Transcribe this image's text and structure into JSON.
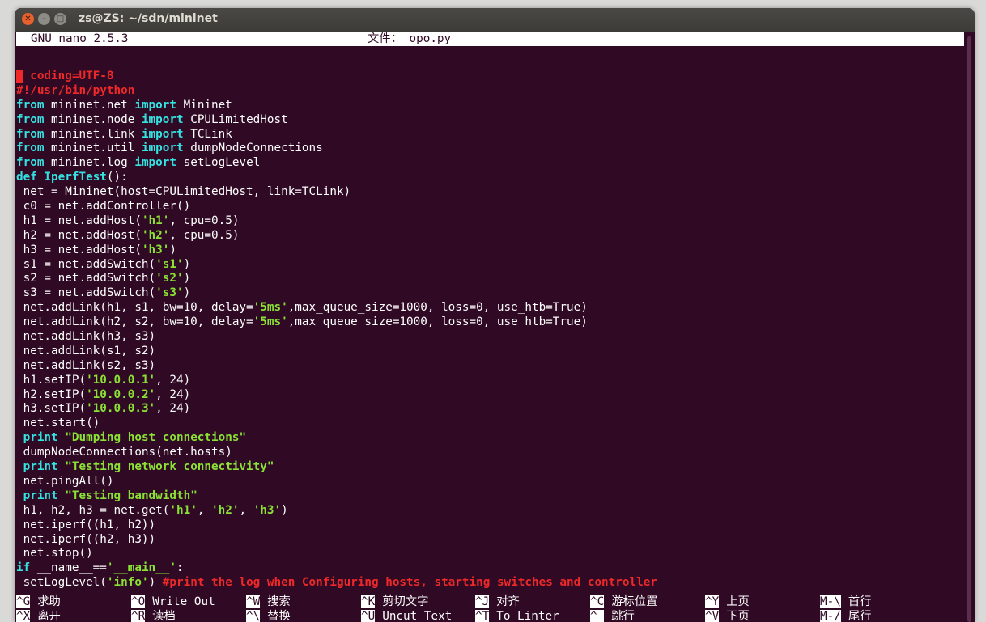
{
  "window": {
    "title": "zs@ZS: ~/sdn/mininet"
  },
  "nano": {
    "version": "GNU nano 2.5.3",
    "file_label": "文件：",
    "file_name": "opo.py"
  },
  "colors": {
    "background": "#300a24",
    "keyword": "#34e2e2",
    "string": "#8ae234",
    "comment": "#ef2929",
    "text": "#ffffff"
  },
  "code_lines": [
    [
      {
        "t": "#",
        "c": "cursor"
      },
      {
        "t": " coding=UTF-8",
        "c": "cmt"
      }
    ],
    [
      {
        "t": "#!/usr/bin/python",
        "c": "cmt"
      }
    ],
    [
      {
        "t": "from",
        "c": "kw"
      },
      {
        "t": " mininet.net "
      },
      {
        "t": "import",
        "c": "kw"
      },
      {
        "t": " Mininet"
      }
    ],
    [
      {
        "t": "from",
        "c": "kw"
      },
      {
        "t": " mininet.node "
      },
      {
        "t": "import",
        "c": "kw"
      },
      {
        "t": " CPULimitedHost"
      }
    ],
    [
      {
        "t": "from",
        "c": "kw"
      },
      {
        "t": " mininet.link "
      },
      {
        "t": "import",
        "c": "kw"
      },
      {
        "t": " TCLink"
      }
    ],
    [
      {
        "t": "from",
        "c": "kw"
      },
      {
        "t": " mininet.util "
      },
      {
        "t": "import",
        "c": "kw"
      },
      {
        "t": " dumpNodeConnections"
      }
    ],
    [
      {
        "t": "from",
        "c": "kw"
      },
      {
        "t": " mininet.log "
      },
      {
        "t": "import",
        "c": "kw"
      },
      {
        "t": " setLogLevel"
      }
    ],
    [
      {
        "t": "def",
        "c": "kw"
      },
      {
        "t": " "
      },
      {
        "t": "IperfTest",
        "c": "kw"
      },
      {
        "t": "():"
      }
    ],
    [
      {
        "t": " net = Mininet(host=CPULimitedHost, link=TCLink)"
      }
    ],
    [
      {
        "t": " c0 = net.addController()"
      }
    ],
    [
      {
        "t": " h1 = net.addHost("
      },
      {
        "t": "'h1'",
        "c": "str"
      },
      {
        "t": ", cpu=0.5)"
      }
    ],
    [
      {
        "t": " h2 = net.addHost("
      },
      {
        "t": "'h2'",
        "c": "str"
      },
      {
        "t": ", cpu=0.5)"
      }
    ],
    [
      {
        "t": " h3 = net.addHost("
      },
      {
        "t": "'h3'",
        "c": "str"
      },
      {
        "t": ")"
      }
    ],
    [
      {
        "t": " s1 = net.addSwitch("
      },
      {
        "t": "'s1'",
        "c": "str"
      },
      {
        "t": ")"
      }
    ],
    [
      {
        "t": " s2 = net.addSwitch("
      },
      {
        "t": "'s2'",
        "c": "str"
      },
      {
        "t": ")"
      }
    ],
    [
      {
        "t": " s3 = net.addSwitch("
      },
      {
        "t": "'s3'",
        "c": "str"
      },
      {
        "t": ")"
      }
    ],
    [
      {
        "t": " net.addLink(h1, s1, bw=10, delay="
      },
      {
        "t": "'5ms'",
        "c": "str"
      },
      {
        "t": ",max_queue_size=1000, loss=0, use_htb=True)"
      }
    ],
    [
      {
        "t": " net.addLink(h2, s2, bw=10, delay="
      },
      {
        "t": "'5ms'",
        "c": "str"
      },
      {
        "t": ",max_queue_size=1000, loss=0, use_htb=True)"
      }
    ],
    [
      {
        "t": " net.addLink(h3, s3)"
      }
    ],
    [
      {
        "t": " net.addLink(s1, s2)"
      }
    ],
    [
      {
        "t": " net.addLink(s2, s3)"
      }
    ],
    [
      {
        "t": " h1.setIP("
      },
      {
        "t": "'10.0.0.1'",
        "c": "str"
      },
      {
        "t": ", 24)"
      }
    ],
    [
      {
        "t": " h2.setIP("
      },
      {
        "t": "'10.0.0.2'",
        "c": "str"
      },
      {
        "t": ", 24)"
      }
    ],
    [
      {
        "t": " h3.setIP("
      },
      {
        "t": "'10.0.0.3'",
        "c": "str"
      },
      {
        "t": ", 24)"
      }
    ],
    [
      {
        "t": " net.start()"
      }
    ],
    [
      {
        "t": " "
      },
      {
        "t": "print",
        "c": "kw"
      },
      {
        "t": " "
      },
      {
        "t": "\"Dumping host connections\"",
        "c": "str"
      }
    ],
    [
      {
        "t": " dumpNodeConnections(net.hosts)"
      }
    ],
    [
      {
        "t": " "
      },
      {
        "t": "print",
        "c": "kw"
      },
      {
        "t": " "
      },
      {
        "t": "\"Testing network connectivity\"",
        "c": "str"
      }
    ],
    [
      {
        "t": " net.pingAll()"
      }
    ],
    [
      {
        "t": " "
      },
      {
        "t": "print",
        "c": "kw"
      },
      {
        "t": " "
      },
      {
        "t": "\"Testing bandwidth\"",
        "c": "str"
      }
    ],
    [
      {
        "t": " h1, h2, h3 = net.get("
      },
      {
        "t": "'h1'",
        "c": "str"
      },
      {
        "t": ", "
      },
      {
        "t": "'h2'",
        "c": "str"
      },
      {
        "t": ", "
      },
      {
        "t": "'h3'",
        "c": "str"
      },
      {
        "t": ")"
      }
    ],
    [
      {
        "t": " net.iperf((h1, h2))"
      }
    ],
    [
      {
        "t": " net.iperf((h2, h3))"
      }
    ],
    [
      {
        "t": " net.stop()"
      }
    ],
    [
      {
        "t": "if",
        "c": "kw"
      },
      {
        "t": " __name__=="
      },
      {
        "t": "'__main__'",
        "c": "str"
      },
      {
        "t": ":"
      }
    ],
    [
      {
        "t": " setLogLevel("
      },
      {
        "t": "'info'",
        "c": "str"
      },
      {
        "t": ") "
      },
      {
        "t": "#print the log when Configuring hosts, starting switches and controller",
        "c": "cmt"
      }
    ]
  ],
  "shortcuts": [
    {
      "key": "^G",
      "label": "求助"
    },
    {
      "key": "^O",
      "label": "Write Out"
    },
    {
      "key": "^W",
      "label": "搜索"
    },
    {
      "key": "^K",
      "label": "剪切文字"
    },
    {
      "key": "^J",
      "label": "对齐"
    },
    {
      "key": "^C",
      "label": "游标位置"
    },
    {
      "key": "^Y",
      "label": "上页"
    },
    {
      "key": "M-\\",
      "label": "首行"
    },
    {
      "key": "^X",
      "label": "离开"
    },
    {
      "key": "^R",
      "label": "读档"
    },
    {
      "key": "^\\",
      "label": "替换"
    },
    {
      "key": "^U",
      "label": "Uncut Text"
    },
    {
      "key": "^T",
      "label": "To Linter"
    },
    {
      "key": "^_",
      "label": "跳行"
    },
    {
      "key": "^V",
      "label": "下页"
    },
    {
      "key": "M-/",
      "label": "尾行"
    }
  ]
}
